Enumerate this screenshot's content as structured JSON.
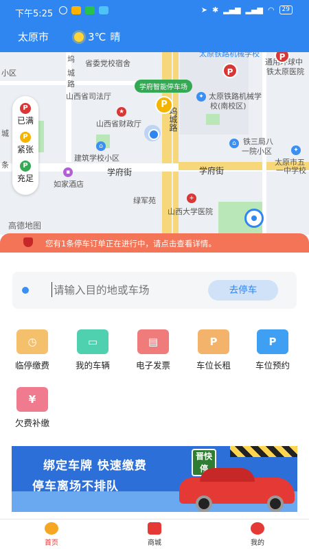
{
  "status_bar": {
    "time": "下午5:25",
    "battery": "29"
  },
  "header": {
    "city": "太原市",
    "temperature": "3℃",
    "condition": "晴"
  },
  "map": {
    "labels": [
      {
        "text": "省委党校宿舍"
      },
      {
        "text": "太原铁路机械学校"
      },
      {
        "text": "通用环球中"
      },
      {
        "text": "铁太原医院"
      },
      {
        "text": "小区"
      },
      {
        "text": "坞"
      },
      {
        "text": "城"
      },
      {
        "text": "路"
      },
      {
        "text": "山西省司法厅"
      },
      {
        "text": "学府智能停车场"
      },
      {
        "text": "太原铁路机械学"
      },
      {
        "text": "校(南校区)"
      },
      {
        "text": "坞城路"
      },
      {
        "text": "山西省财政厅"
      },
      {
        "text": "铁三局八"
      },
      {
        "text": "一院小区"
      },
      {
        "text": "建筑学校小区"
      },
      {
        "text": "太原市五"
      },
      {
        "text": "一中学校"
      },
      {
        "text": "学府街"
      },
      {
        "text": "学府街"
      },
      {
        "text": "如家酒店"
      },
      {
        "text": "绿军苑"
      },
      {
        "text": "山西大学医院"
      },
      {
        "text": "高德地图"
      },
      {
        "text": "城"
      },
      {
        "text": "条"
      }
    ],
    "parking_tag": "学府智能停车场",
    "legend": [
      {
        "letter": "P",
        "label": "已满",
        "color": "#d93636"
      },
      {
        "letter": "P",
        "label": "紧张",
        "color": "#f4b400"
      },
      {
        "letter": "P",
        "label": "充足",
        "color": "#34a853"
      }
    ],
    "logo": "高德地图"
  },
  "notice": {
    "text": "您有1条停车订单正在进行中，请点击查看详情。"
  },
  "search": {
    "placeholder": "请输入目的地或车场",
    "button": "去停车"
  },
  "services": [
    {
      "label": "临停缴费",
      "color": "#f4c06b",
      "icon": "clock-icon"
    },
    {
      "label": "我的车辆",
      "color": "#4fd1b0",
      "icon": "car-icon"
    },
    {
      "label": "电子发票",
      "color": "#f07b7b",
      "icon": "ticket-icon"
    },
    {
      "label": "车位长租",
      "color": "#f3b36a",
      "icon": "tag-icon"
    },
    {
      "label": "车位预约",
      "color": "#3f9ff2",
      "icon": "parking-icon"
    },
    {
      "label": "欠费补缴",
      "color": "#f07b8f",
      "icon": "wallet-icon"
    }
  ],
  "ad": {
    "line1": "绑定车牌 快速缴费",
    "line2": "停车离场不排队",
    "badge": "晋快停"
  },
  "nav": [
    {
      "label": "首页",
      "active": true
    },
    {
      "label": "商城",
      "active": false
    },
    {
      "label": "我的",
      "active": false
    }
  ]
}
